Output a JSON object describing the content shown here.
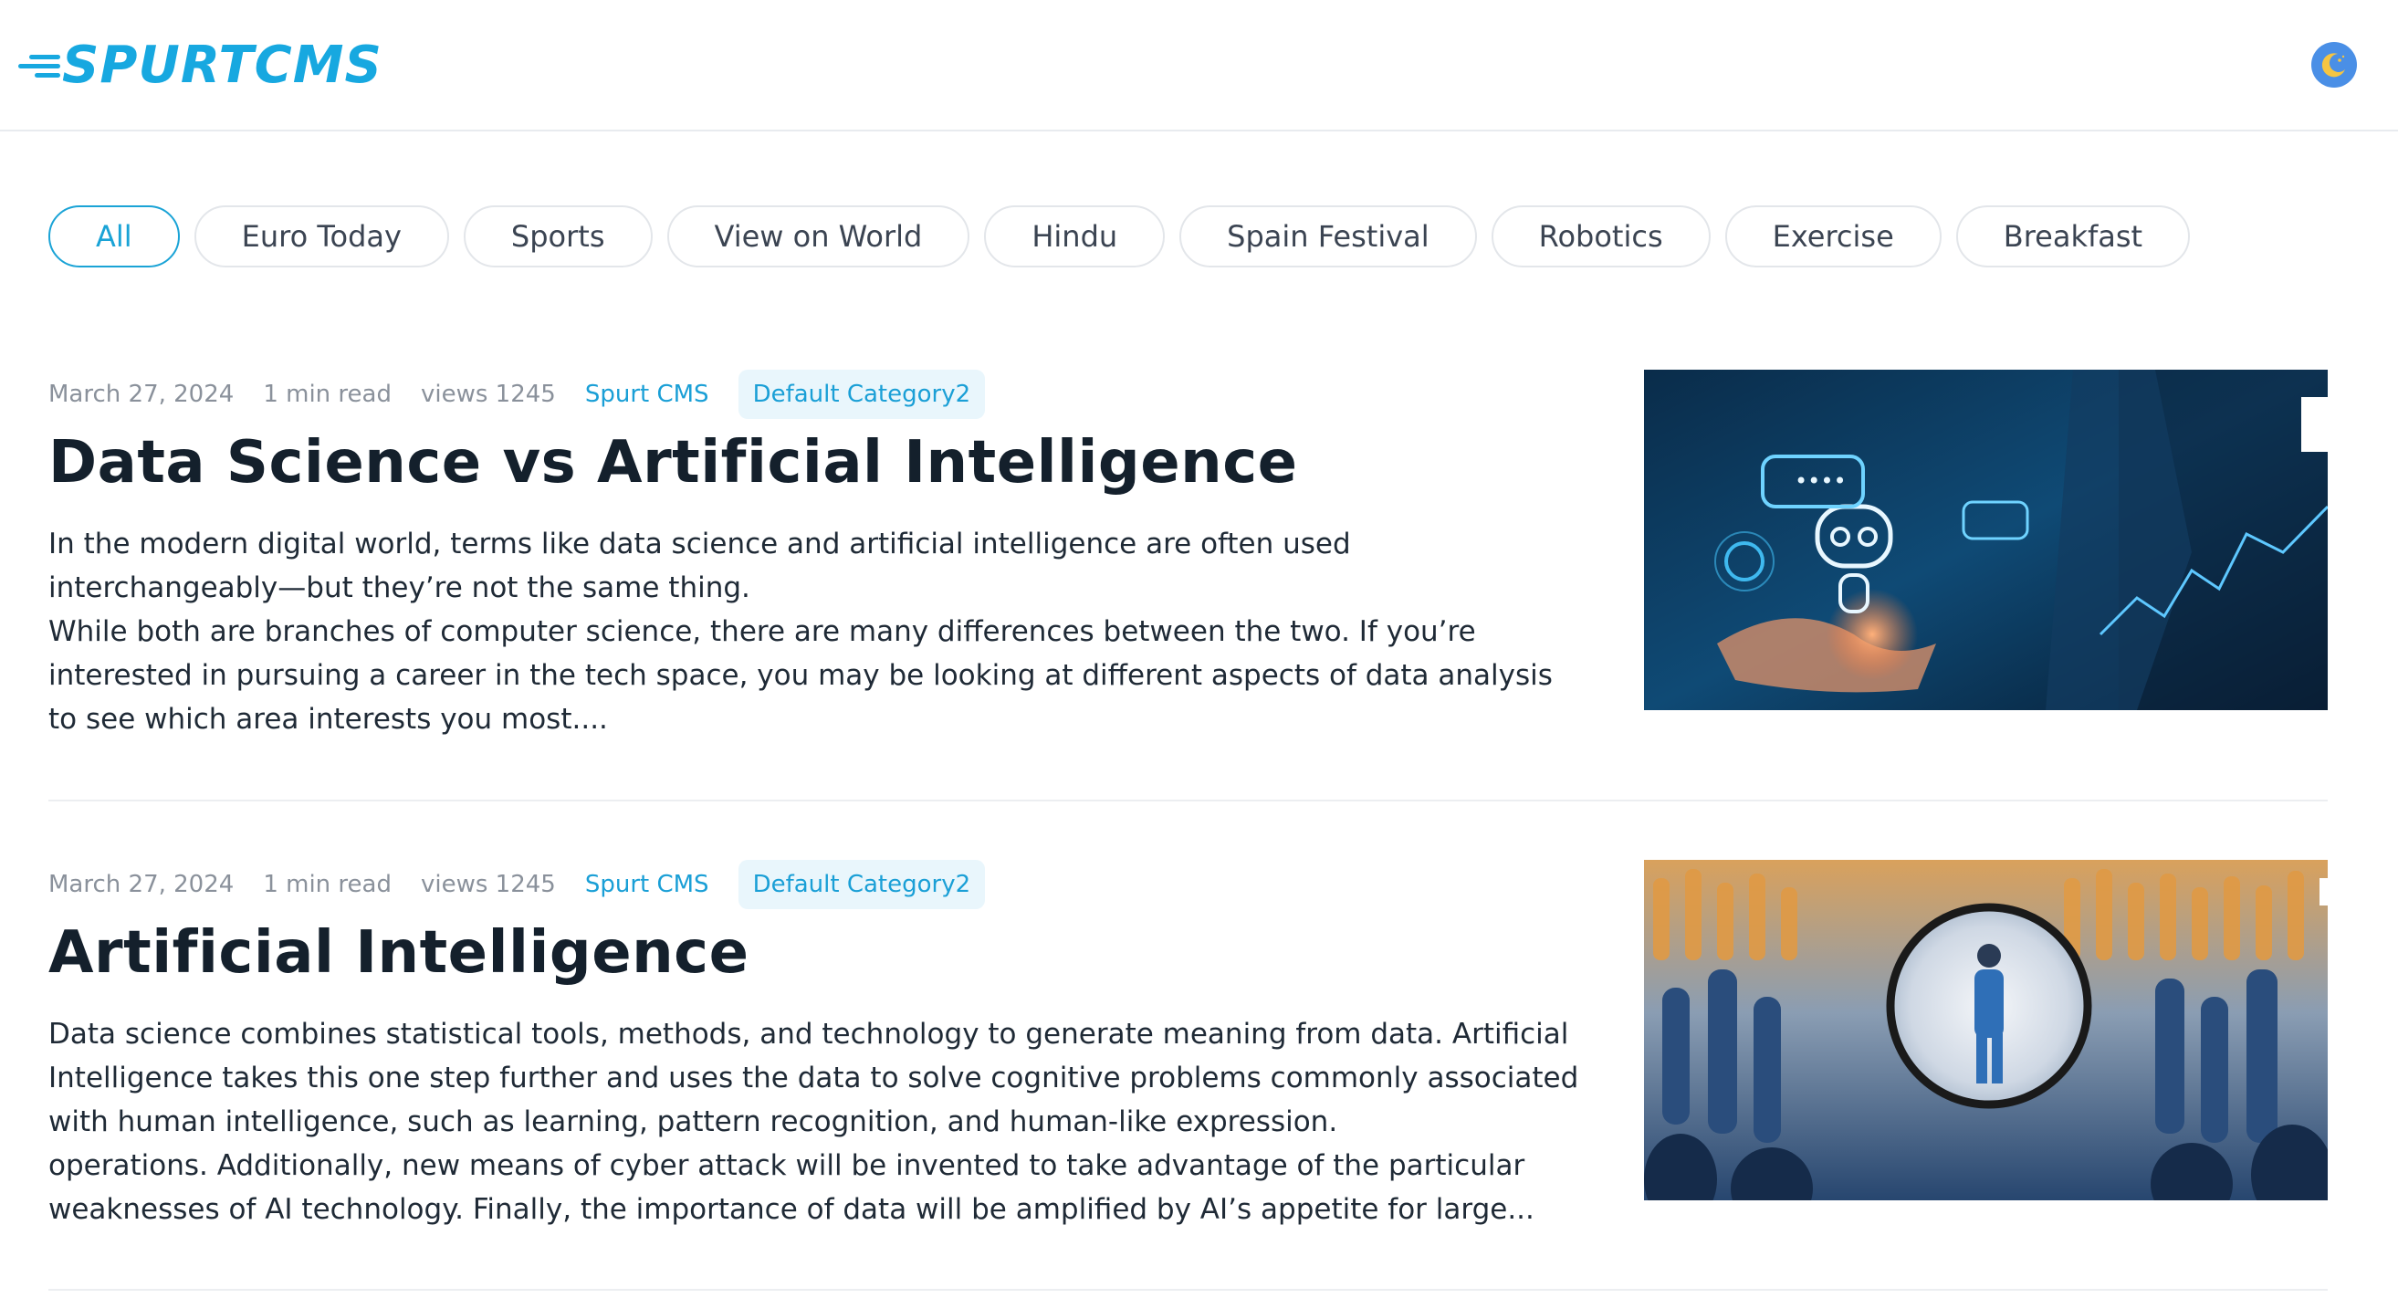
{
  "header": {
    "logo_text": "SPURTCMS",
    "theme_toggle_icon": "moon-icon",
    "brand_color": "#17a8e0"
  },
  "filters": {
    "active": "All",
    "items": [
      "All",
      "Euro Today",
      "Sports",
      "View on World",
      "Hindu",
      "Spain Festival",
      "Robotics",
      "Exercise",
      "Breakfast"
    ]
  },
  "articles": [
    {
      "date": "March 27, 2024",
      "read_time": "1 min read",
      "views": "views 1245",
      "author": "Spurt CMS",
      "category": "Default Category2",
      "title": "Data Science vs Artificial Intelligence",
      "excerpt": [
        "In  the modern digital world, terms like data science and artificial  intelligence are often used interchangeably—but they’re not the same  thing.",
        "While both are branches of computer science, there are many  differences between the two. If you’re interested in pursuing a career  in the tech space, you may be looking at different aspects of data analysis to see which area interests you most...."
      ],
      "image": "ai-robot-hand-image"
    },
    {
      "date": "March 27, 2024",
      "read_time": "1 min read",
      "views": "views 1245",
      "author": "Spurt CMS",
      "category": "Default Category2",
      "title": "Artificial Intelligence",
      "excerpt": [
        "Data science combines statistical tools, methods, and technology to generate meaning from data. Artificial Intelligence takes this one step further and uses the data to solve cognitive problems commonly associated with human intelligence, such as learning, pattern recognition, and human-like expression.",
        "operations. Additionally, new means of cyber attack will be invented to take advantage of the particular weaknesses of AI technology. Finally, the importance of data will be amplified by AI’s appetite for large..."
      ],
      "image": "crowd-magnifier-image"
    }
  ]
}
